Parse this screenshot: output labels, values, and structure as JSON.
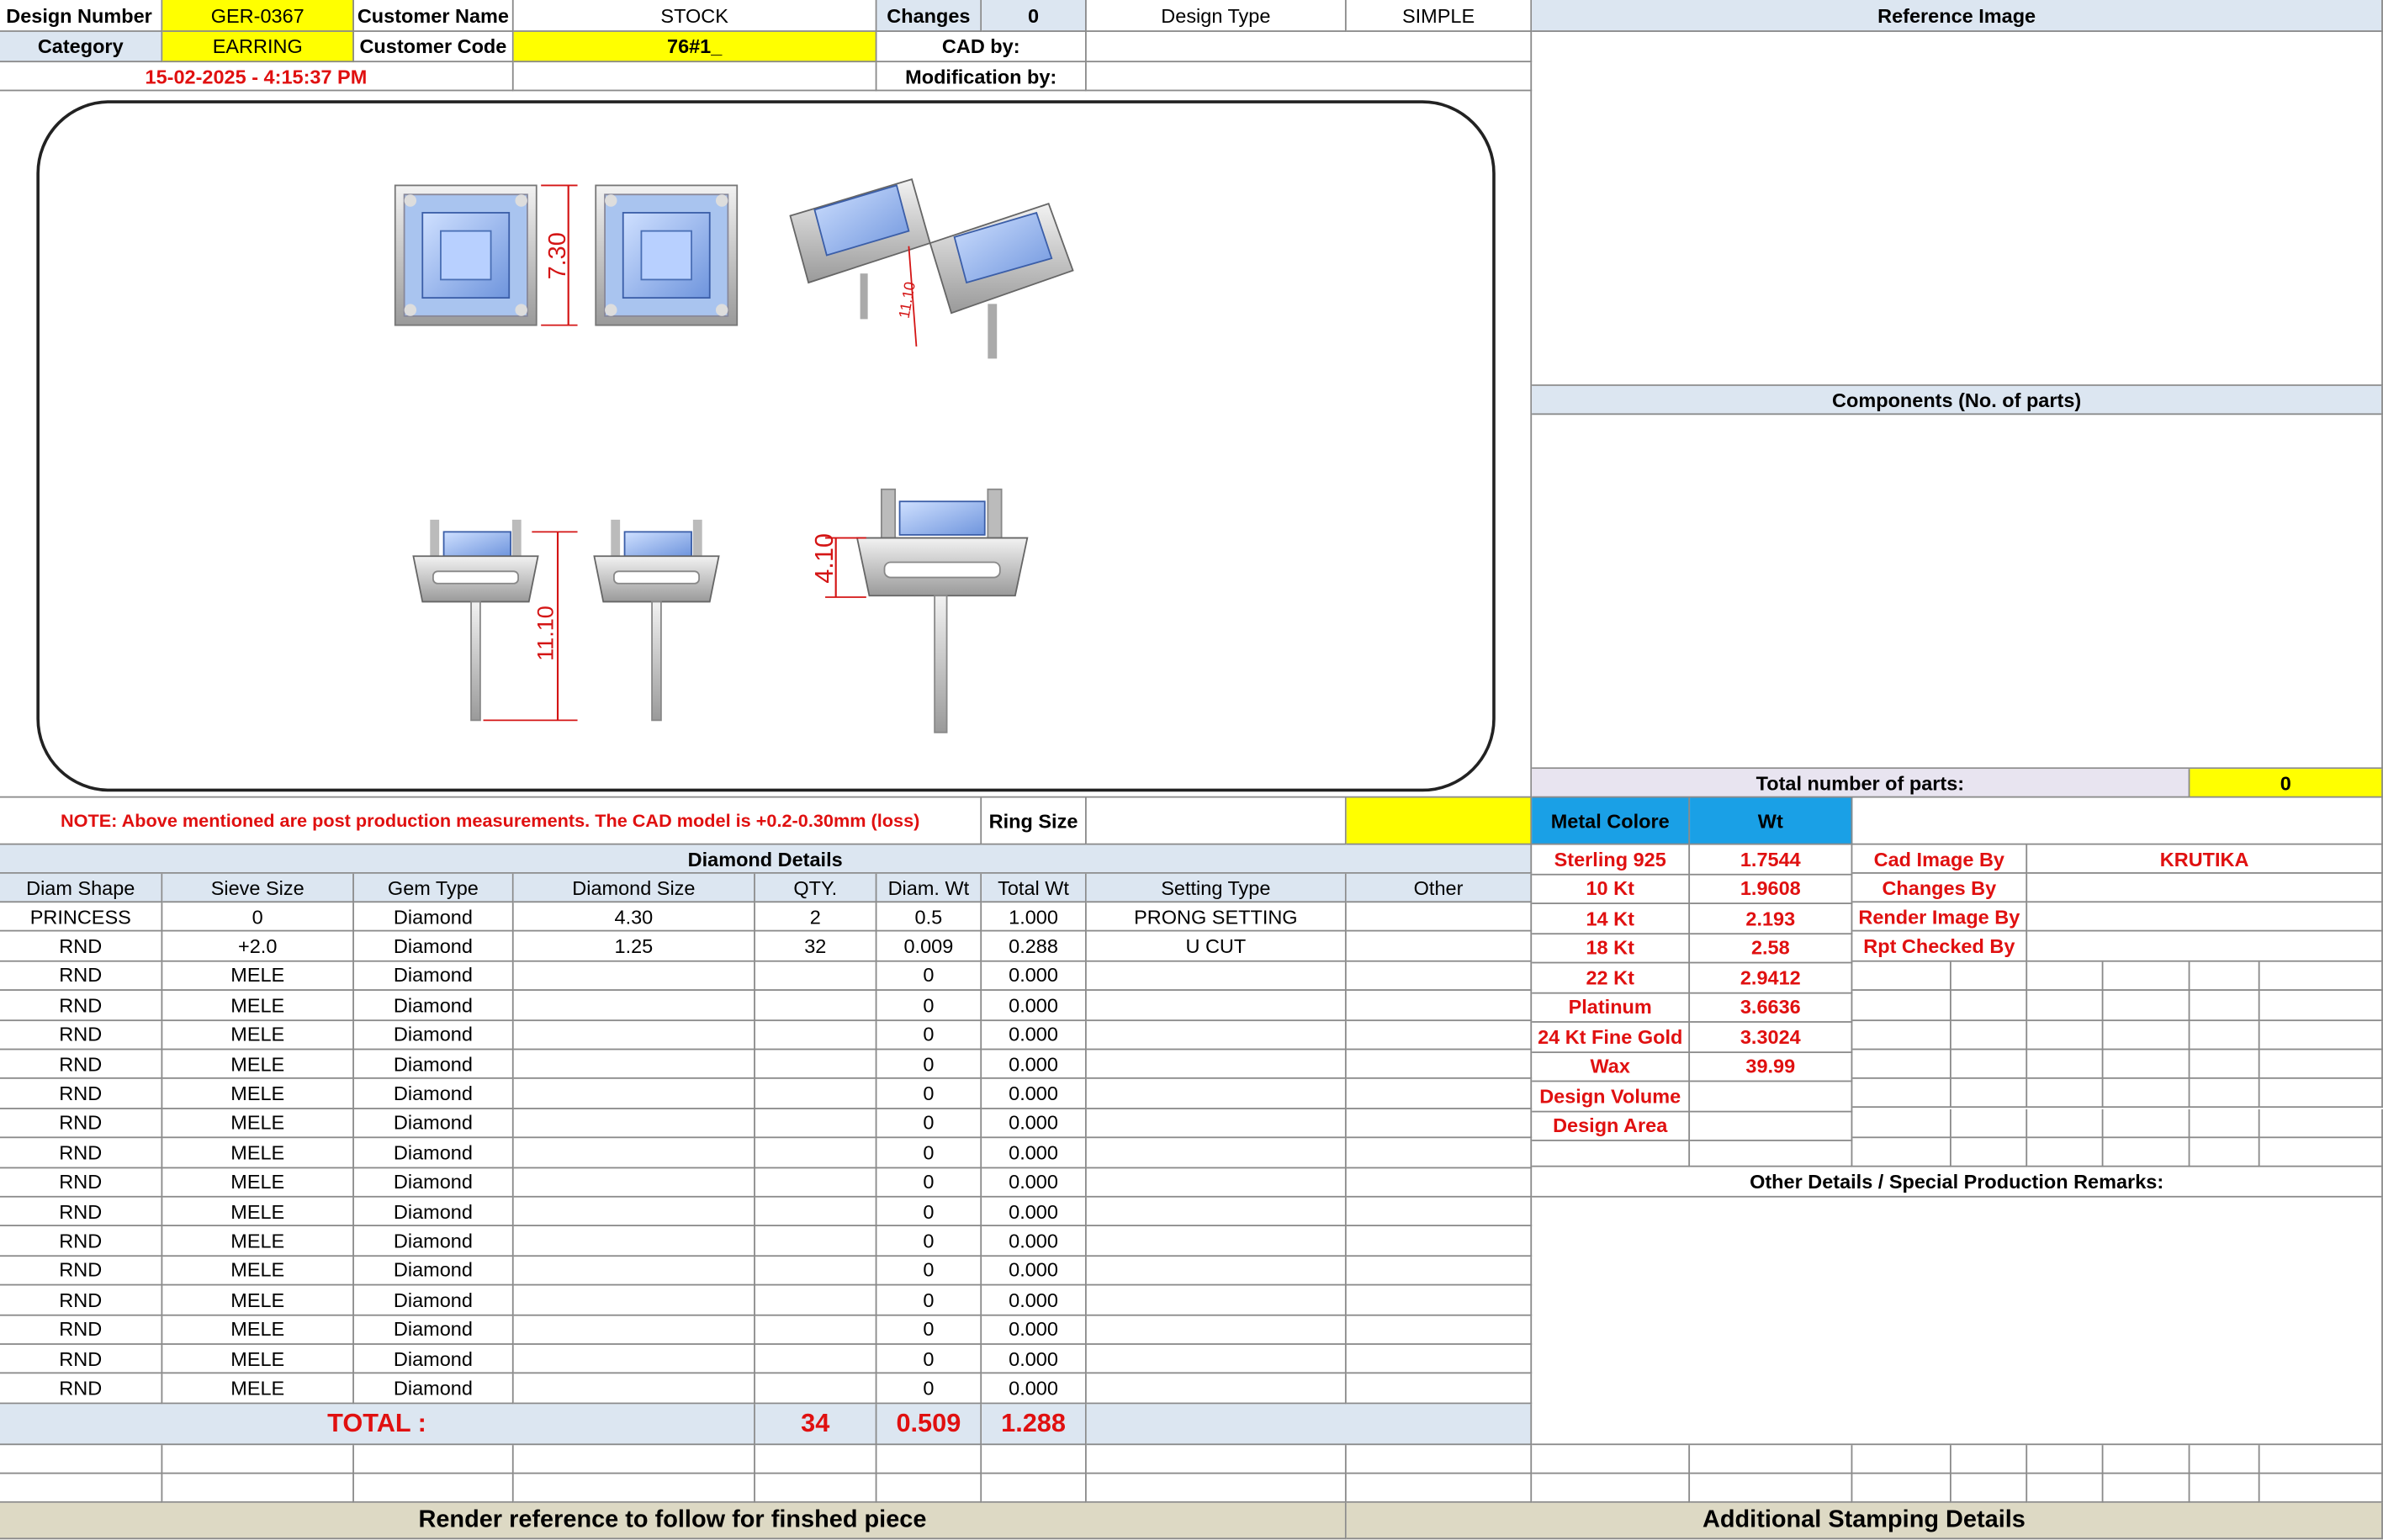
{
  "header": {
    "design_number_label": "Design Number",
    "design_number": "GER-0367",
    "customer_name_label": "Customer Name",
    "customer_name": "STOCK",
    "changes_label": "Changes",
    "changes": "0",
    "design_type_label": "Design Type",
    "design_type": "SIMPLE",
    "category_label": "Category",
    "category": "EARRING",
    "customer_code_label": "Customer Code",
    "customer_code": "76#1_",
    "cad_by_label": "CAD by:",
    "timestamp": "15-02-2025 - 4:15:37 PM",
    "modification_by_label": "Modification by:"
  },
  "drawing": {
    "dim_top": "7.30",
    "dim_diag": "11.10",
    "dim_side_height": "11.10",
    "dim_side_small": "4.10"
  },
  "right_panel": {
    "reference_image": "Reference Image",
    "components": "Components (No. of parts)",
    "total_parts_label": "Total number of parts:",
    "total_parts": "0"
  },
  "note": {
    "text": "NOTE: Above mentioned are post production measurements. The CAD model is +0.2-0.30mm (loss)",
    "ring_size_label": "Ring Size"
  },
  "diamond_details": {
    "title": "Diamond Details",
    "columns": [
      "Diam Shape",
      "Sieve Size",
      "Gem Type",
      "Diamond Size",
      "QTY.",
      "Diam. Wt",
      "Total Wt",
      "Setting Type",
      "Other"
    ],
    "rows": [
      [
        "PRINCESS",
        "0",
        "Diamond",
        "4.30",
        "2",
        "0.5",
        "1.000",
        "PRONG SETTING",
        ""
      ],
      [
        "RND",
        "+2.0",
        "Diamond",
        "1.25",
        "32",
        "0.009",
        "0.288",
        "U CUT",
        ""
      ],
      [
        "RND",
        "MELE",
        "Diamond",
        "",
        "",
        "0",
        "0.000",
        "",
        ""
      ],
      [
        "RND",
        "MELE",
        "Diamond",
        "",
        "",
        "0",
        "0.000",
        "",
        ""
      ],
      [
        "RND",
        "MELE",
        "Diamond",
        "",
        "",
        "0",
        "0.000",
        "",
        ""
      ],
      [
        "RND",
        "MELE",
        "Diamond",
        "",
        "",
        "0",
        "0.000",
        "",
        ""
      ],
      [
        "RND",
        "MELE",
        "Diamond",
        "",
        "",
        "0",
        "0.000",
        "",
        ""
      ],
      [
        "RND",
        "MELE",
        "Diamond",
        "",
        "",
        "0",
        "0.000",
        "",
        ""
      ],
      [
        "RND",
        "MELE",
        "Diamond",
        "",
        "",
        "0",
        "0.000",
        "",
        ""
      ],
      [
        "RND",
        "MELE",
        "Diamond",
        "",
        "",
        "0",
        "0.000",
        "",
        ""
      ],
      [
        "RND",
        "MELE",
        "Diamond",
        "",
        "",
        "0",
        "0.000",
        "",
        ""
      ],
      [
        "RND",
        "MELE",
        "Diamond",
        "",
        "",
        "0",
        "0.000",
        "",
        ""
      ],
      [
        "RND",
        "MELE",
        "Diamond",
        "",
        "",
        "0",
        "0.000",
        "",
        ""
      ],
      [
        "RND",
        "MELE",
        "Diamond",
        "",
        "",
        "0",
        "0.000",
        "",
        ""
      ],
      [
        "RND",
        "MELE",
        "Diamond",
        "",
        "",
        "0",
        "0.000",
        "",
        ""
      ],
      [
        "RND",
        "MELE",
        "Diamond",
        "",
        "",
        "0",
        "0.000",
        "",
        ""
      ],
      [
        "RND",
        "MELE",
        "Diamond",
        "",
        "",
        "0",
        "0.000",
        "",
        ""
      ]
    ],
    "total_label": "TOTAL :",
    "total_qty": "34",
    "total_diam_wt": "0.509",
    "total_wt": "1.288"
  },
  "metal": {
    "color_label": "Metal Colore",
    "wt_label": "Wt",
    "rows": [
      [
        "Sterling 925",
        "1.7544"
      ],
      [
        "10 Kt",
        "1.9608"
      ],
      [
        "14 Kt",
        "2.193"
      ],
      [
        "18 Kt",
        "2.58"
      ],
      [
        "22 Kt",
        "2.9412"
      ],
      [
        "Platinum",
        "3.6636"
      ],
      [
        "24 Kt Fine Gold",
        "3.3024"
      ],
      [
        "Wax",
        "39.99"
      ],
      [
        "Design Volume",
        ""
      ],
      [
        "Design Area",
        ""
      ]
    ]
  },
  "credits": {
    "cad_image_by_label": "Cad Image By",
    "cad_image_by": "KRUTIKA",
    "changes_by_label": "Changes By",
    "render_image_by_label": "Render Image By",
    "rpt_checked_by_label": "Rpt Checked By"
  },
  "other_details": "Other Details / Special Production Remarks:",
  "footer": {
    "render_reference": "Render reference to follow for finshed piece",
    "stamping": "Additional Stamping Details"
  }
}
